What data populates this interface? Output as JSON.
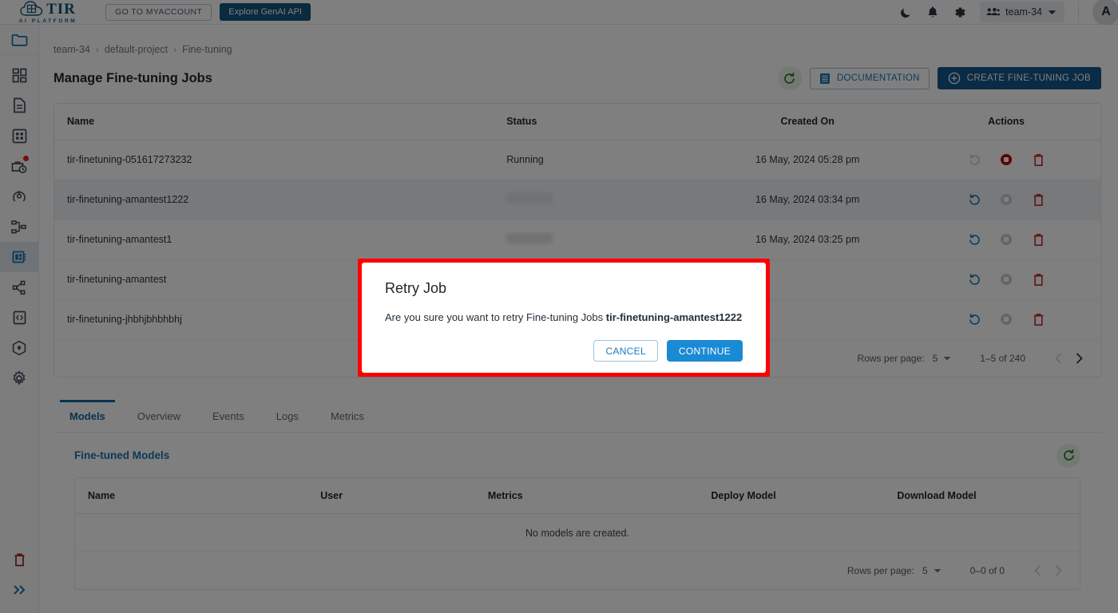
{
  "topbar": {
    "logo_text": "TIR",
    "logo_subtitle": "AI PLATFORM",
    "myaccount_label": "GO TO MYACCOUNT",
    "genai_label": "Explore GenAI API",
    "team_label": "team-34",
    "avatar_initial": "A"
  },
  "breadcrumb": {
    "team": "team-34",
    "project": "default-project",
    "section": "Fine-tuning",
    "separator": "›"
  },
  "page": {
    "title": "Manage Fine-tuning Jobs",
    "documentation_label": "DOCUMENTATION",
    "create_label": "CREATE FINE-TUNING JOB"
  },
  "jobs_table": {
    "columns": [
      "Name",
      "Status",
      "Created On",
      "Actions"
    ],
    "rows": [
      {
        "name": "tir-finetuning-051617273232",
        "status": "Running",
        "created_on": "16 May, 2024 05:28 pm",
        "retry_enabled": false,
        "stop_enabled": true,
        "hovered": false
      },
      {
        "name": "tir-finetuning-amantest1222",
        "status": "",
        "created_on": "16 May, 2024 03:34 pm",
        "retry_enabled": true,
        "stop_enabled": false,
        "hovered": true
      },
      {
        "name": "tir-finetuning-amantest1",
        "status": "",
        "created_on": "16 May, 2024 03:25 pm",
        "retry_enabled": true,
        "stop_enabled": false,
        "hovered": false
      },
      {
        "name": "tir-finetuning-amantest",
        "status": "",
        "created_on": "",
        "retry_enabled": true,
        "stop_enabled": false,
        "hovered": false
      },
      {
        "name": "tir-finetuning-jhbhjbhbhbhj",
        "status": "",
        "created_on": "",
        "retry_enabled": true,
        "stop_enabled": false,
        "hovered": false
      }
    ],
    "pagination": {
      "rows_per_page_label": "Rows per page:",
      "rows_per_page_value": "5",
      "range": "1–5 of 240"
    }
  },
  "tabs": [
    {
      "label": "Models",
      "active": true
    },
    {
      "label": "Overview",
      "active": false
    },
    {
      "label": "Events",
      "active": false
    },
    {
      "label": "Logs",
      "active": false
    },
    {
      "label": "Metrics",
      "active": false
    }
  ],
  "models_section": {
    "title": "Fine-tuned Models",
    "columns": [
      "Name",
      "User",
      "Metrics",
      "Deploy Model",
      "Download Model"
    ],
    "empty_text": "No models are created.",
    "pagination": {
      "rows_per_page_label": "Rows per page:",
      "rows_per_page_value": "5",
      "range": "0–0 of 0"
    }
  },
  "modal": {
    "title": "Retry Job",
    "body_prefix": "Are you sure you want to retry Fine-tuning Jobs ",
    "body_job_name": "tir-finetuning-amantest1222",
    "cancel_label": "CANCEL",
    "continue_label": "CONTINUE"
  },
  "colors": {
    "brand_blue": "#14568b",
    "link_blue": "#1976b8",
    "accent_blue": "#1a8ad4",
    "danger_red": "#c62828",
    "stop_red": "#b9000e",
    "success_green": "#1e7a1e",
    "annotation_red": "#ff0000"
  }
}
